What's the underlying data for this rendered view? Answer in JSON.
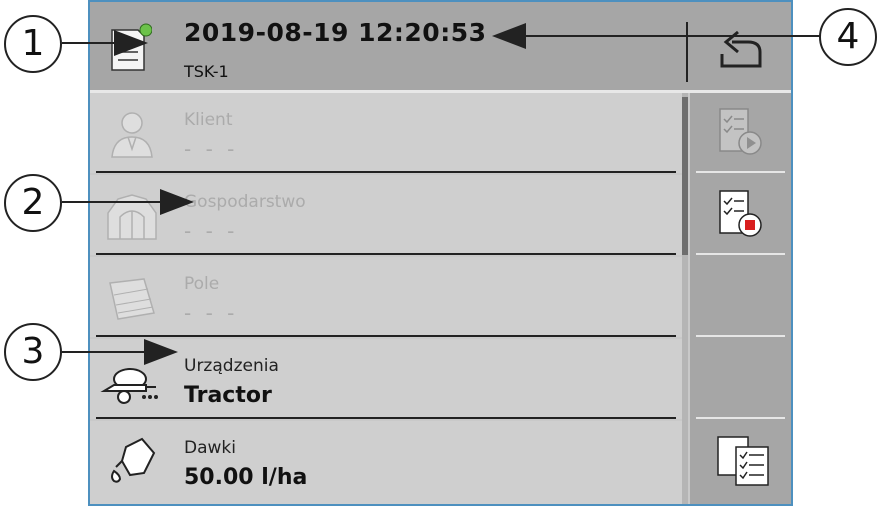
{
  "header": {
    "title": "2019-08-19 12:20:53",
    "subtitle": "TSK-1",
    "status_indicator_color": "#6cc24a",
    "back_icon": "return-arrow-icon"
  },
  "rows": [
    {
      "label": "Klient",
      "value": "- - -",
      "icon": "customer-icon",
      "enabled": false
    },
    {
      "label": "Gospodarstwo",
      "value": "- - -",
      "icon": "farm-icon",
      "enabled": false
    },
    {
      "label": "Pole",
      "value": "- - -",
      "icon": "field-icon",
      "enabled": false
    },
    {
      "label": "Urządzenia",
      "value": "Tractor",
      "icon": "machine-icon",
      "enabled": true
    },
    {
      "label": "Dawki",
      "value": "50.00 l/ha",
      "icon": "rate-icon",
      "enabled": true
    }
  ],
  "softkeys": [
    {
      "icon": "start-task-icon",
      "enabled": false
    },
    {
      "icon": "stop-task-icon",
      "enabled": true
    },
    {
      "icon": "",
      "enabled": false
    },
    {
      "icon": "",
      "enabled": false
    },
    {
      "icon": "task-list-icon",
      "enabled": true
    }
  ],
  "callouts": [
    "1",
    "2",
    "3",
    "4"
  ]
}
